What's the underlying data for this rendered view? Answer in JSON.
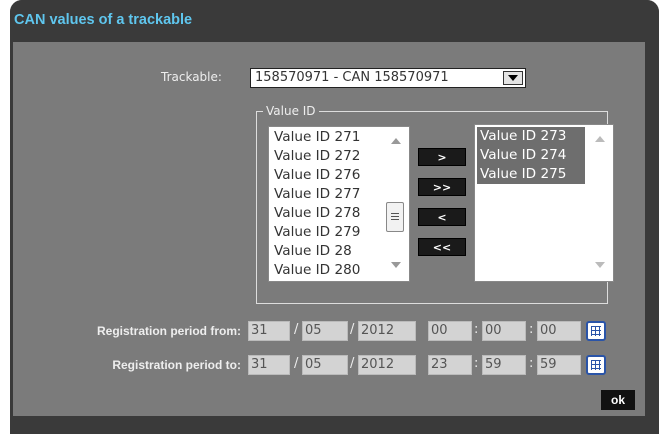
{
  "dialog": {
    "title": "CAN values of a trackable",
    "accent": "#5fc6ee",
    "frame_color": "#3a3a3a",
    "body_color": "#7b7b7b"
  },
  "trackable": {
    "label": "Trackable:",
    "value": "158570971 - CAN 158570971",
    "icon": "dropdown-arrow-icon"
  },
  "value_id": {
    "legend": "Value ID",
    "available": [
      "Value ID 271",
      "Value ID 272",
      "Value ID 276",
      "Value ID 277",
      "Value ID 278",
      "Value ID 279",
      "Value ID 28",
      "Value ID 280"
    ],
    "selected": [
      "Value ID 273",
      "Value ID 274",
      "Value ID 275"
    ],
    "buttons": {
      "add": ">",
      "add_all": ">>",
      "remove": "<",
      "remove_all": "<<"
    }
  },
  "period_from": {
    "label": "Registration period from:",
    "day": "31",
    "month": "05",
    "year": "2012",
    "hour": "00",
    "minute": "00",
    "second": "00"
  },
  "period_to": {
    "label": "Registration period to:",
    "day": "31",
    "month": "05",
    "year": "2012",
    "hour": "23",
    "minute": "59",
    "second": "59"
  },
  "separators": {
    "date": "/",
    "time": ":"
  },
  "icons": {
    "calendar": "calendar-icon"
  },
  "ok_label": "ok"
}
